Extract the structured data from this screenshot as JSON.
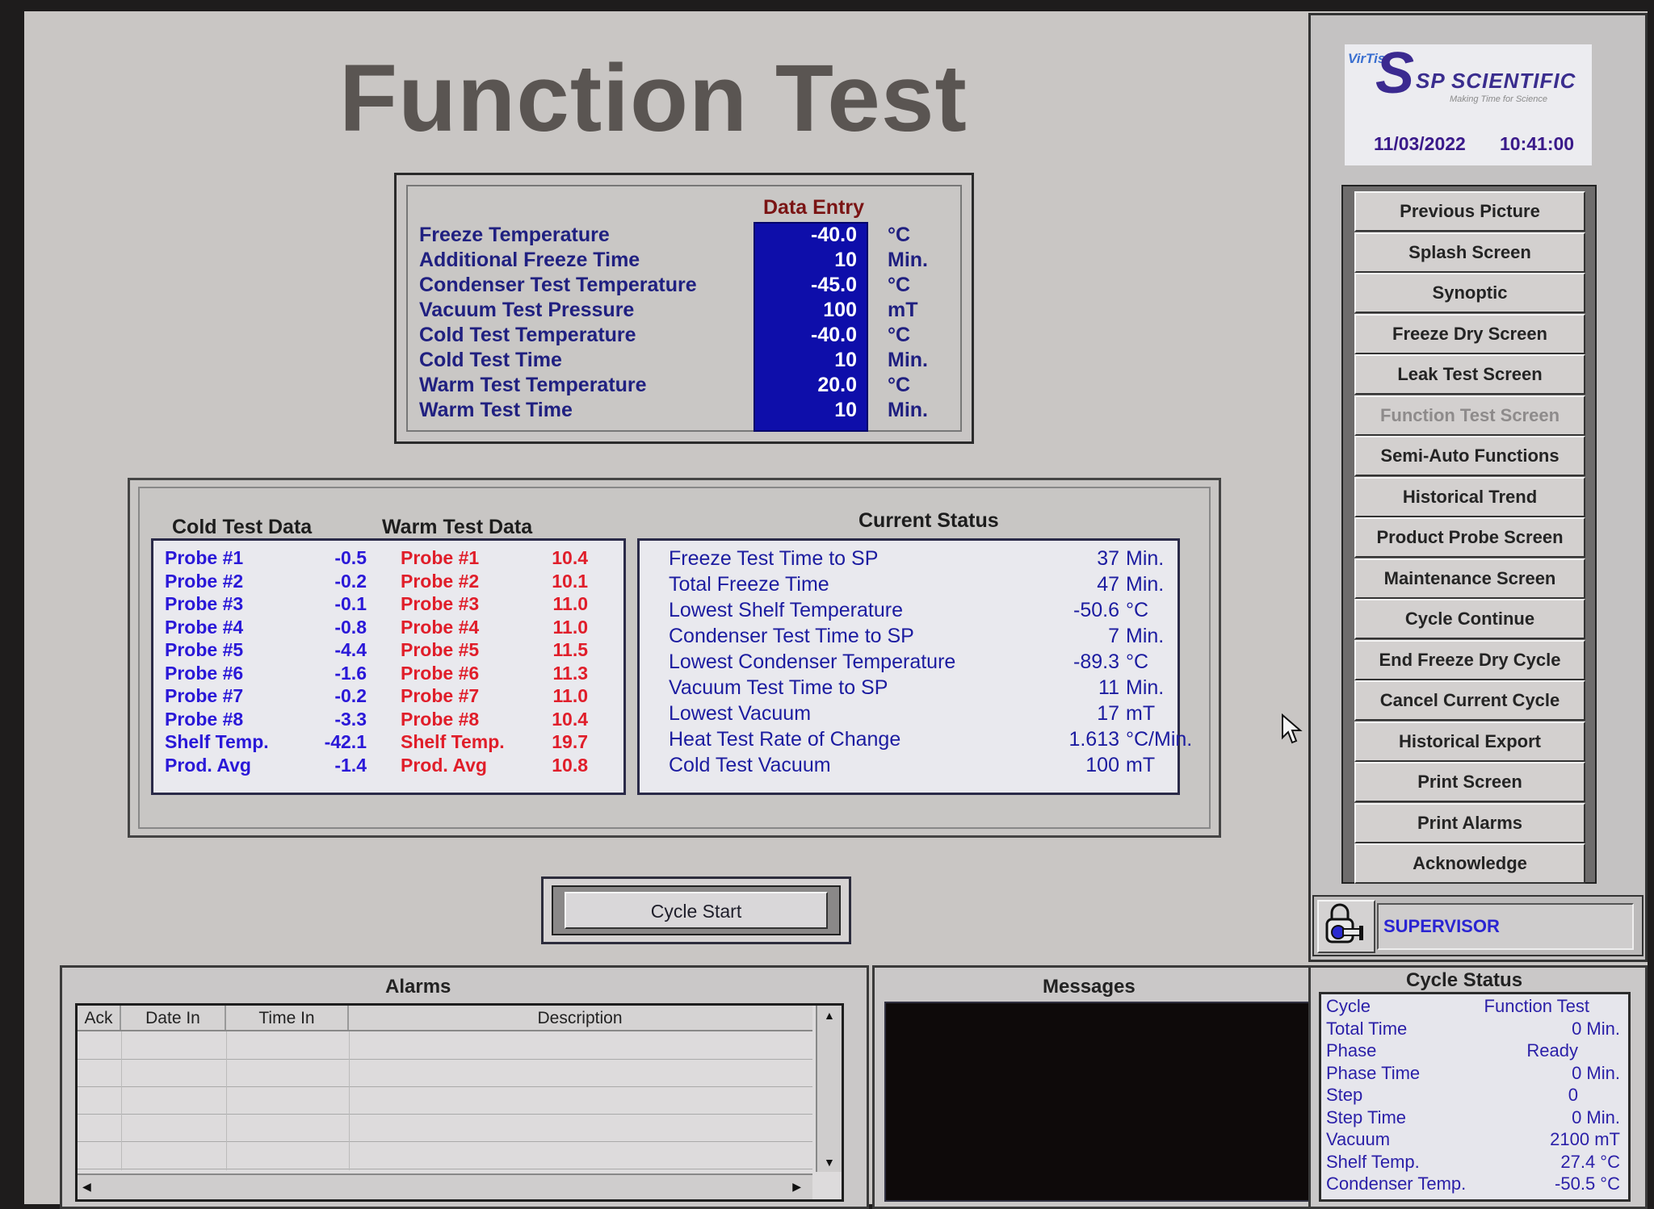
{
  "page_title": "Function Test",
  "data_entry": {
    "heading": "Data Entry",
    "rows": [
      {
        "label": "Freeze Temperature",
        "value": "-40.0",
        "unit": "°C"
      },
      {
        "label": "Additional Freeze Time",
        "value": "10",
        "unit": "Min."
      },
      {
        "label": "Condenser Test Temperature",
        "value": "-45.0",
        "unit": "°C"
      },
      {
        "label": "Vacuum Test Pressure",
        "value": "100",
        "unit": "mT"
      },
      {
        "label": "Cold Test Temperature",
        "value": "-40.0",
        "unit": "°C"
      },
      {
        "label": "Cold Test Time",
        "value": "10",
        "unit": "Min."
      },
      {
        "label": "Warm Test Temperature",
        "value": "20.0",
        "unit": "°C"
      },
      {
        "label": "Warm Test Time",
        "value": "10",
        "unit": "Min."
      }
    ]
  },
  "cold_test": {
    "heading": "Cold Test Data",
    "rows": [
      {
        "label": "Probe #1",
        "value": "-0.5"
      },
      {
        "label": "Probe #2",
        "value": "-0.2"
      },
      {
        "label": "Probe #3",
        "value": "-0.1"
      },
      {
        "label": "Probe #4",
        "value": "-0.8"
      },
      {
        "label": "Probe #5",
        "value": "-4.4"
      },
      {
        "label": "Probe #6",
        "value": "-1.6"
      },
      {
        "label": "Probe #7",
        "value": "-0.2"
      },
      {
        "label": "Probe #8",
        "value": "-3.3"
      },
      {
        "label": "Shelf Temp.",
        "value": "-42.1"
      },
      {
        "label": "Prod. Avg",
        "value": "-1.4"
      }
    ]
  },
  "warm_test": {
    "heading": "Warm Test Data",
    "rows": [
      {
        "label": "Probe #1",
        "value": "10.4"
      },
      {
        "label": "Probe #2",
        "value": "10.1"
      },
      {
        "label": "Probe #3",
        "value": "11.0"
      },
      {
        "label": "Probe #4",
        "value": "11.0"
      },
      {
        "label": "Probe #5",
        "value": "11.5"
      },
      {
        "label": "Probe #6",
        "value": "11.3"
      },
      {
        "label": "Probe #7",
        "value": "11.0"
      },
      {
        "label": "Probe #8",
        "value": "10.4"
      },
      {
        "label": "Shelf Temp.",
        "value": "19.7"
      },
      {
        "label": "Prod. Avg",
        "value": "10.8"
      }
    ]
  },
  "current_status": {
    "heading": "Current Status",
    "rows": [
      {
        "label": "Freeze Test Time to SP",
        "value": "37",
        "unit": "Min."
      },
      {
        "label": "Total Freeze Time",
        "value": "47",
        "unit": "Min."
      },
      {
        "label": "Lowest Shelf Temperature",
        "value": "-50.6",
        "unit": "°C"
      },
      {
        "label": "Condenser Test Time to SP",
        "value": "7",
        "unit": "Min."
      },
      {
        "label": "Lowest Condenser Temperature",
        "value": "-89.3",
        "unit": "°C"
      },
      {
        "label": "Vacuum Test Time to SP",
        "value": "11",
        "unit": "Min."
      },
      {
        "label": "Lowest Vacuum",
        "value": "17",
        "unit": "mT"
      },
      {
        "label": "Heat Test Rate of Change",
        "value": "1.613",
        "unit": "°C/Min."
      },
      {
        "label": "Cold Test Vacuum",
        "value": "100",
        "unit": "mT"
      }
    ]
  },
  "cycle_start_label": "Cycle Start",
  "alarms": {
    "title": "Alarms",
    "columns": [
      "Ack",
      "Date In",
      "Time In",
      "Description"
    ],
    "rows": []
  },
  "messages": {
    "title": "Messages"
  },
  "sidebar": {
    "logo": {
      "brand_small": "VirTis",
      "brand": "SP SCIENTIFIC",
      "tagline": "Making Time for Science",
      "date": "11/03/2022",
      "time": "10:41:00"
    },
    "nav": [
      {
        "label": "Previous Picture",
        "active": false
      },
      {
        "label": "Splash Screen",
        "active": false
      },
      {
        "label": "Synoptic",
        "active": false
      },
      {
        "label": "Freeze Dry Screen",
        "active": false
      },
      {
        "label": "Leak Test Screen",
        "active": false
      },
      {
        "label": "Function Test Screen",
        "active": true
      },
      {
        "label": "Semi-Auto Functions",
        "active": false
      },
      {
        "label": "Historical Trend",
        "active": false
      },
      {
        "label": "Product Probe Screen",
        "active": false
      },
      {
        "label": "Maintenance Screen",
        "active": false
      },
      {
        "label": "Cycle Continue",
        "active": false
      },
      {
        "label": "End Freeze Dry Cycle",
        "active": false
      },
      {
        "label": "Cancel Current Cycle",
        "active": false
      },
      {
        "label": "Historical Export",
        "active": false
      },
      {
        "label": "Print Screen",
        "active": false
      },
      {
        "label": "Print Alarms",
        "active": false
      },
      {
        "label": "Acknowledge",
        "active": false
      }
    ],
    "user": "SUPERVISOR"
  },
  "cycle_status": {
    "title": "Cycle Status",
    "rows": [
      {
        "label": "Cycle",
        "value": "Function Test"
      },
      {
        "label": "Total Time",
        "value": "0 Min."
      },
      {
        "label": "Phase",
        "value": "Ready"
      },
      {
        "label": "Phase Time",
        "value": "0 Min."
      },
      {
        "label": "Step",
        "value": "0"
      },
      {
        "label": "Step Time",
        "value": "0 Min."
      },
      {
        "label": "Vacuum",
        "value": "2100 mT"
      },
      {
        "label": "Shelf Temp.",
        "value": "27.4 °C"
      },
      {
        "label": "Condenser Temp.",
        "value": "-50.5 °C"
      }
    ]
  },
  "colors": {
    "entry_field_bg": "#0e0eaa",
    "cold_text": "#2a18d8",
    "warm_text": "#e01e2a",
    "heading_red": "#7a1414",
    "label_blue": "#202080"
  }
}
